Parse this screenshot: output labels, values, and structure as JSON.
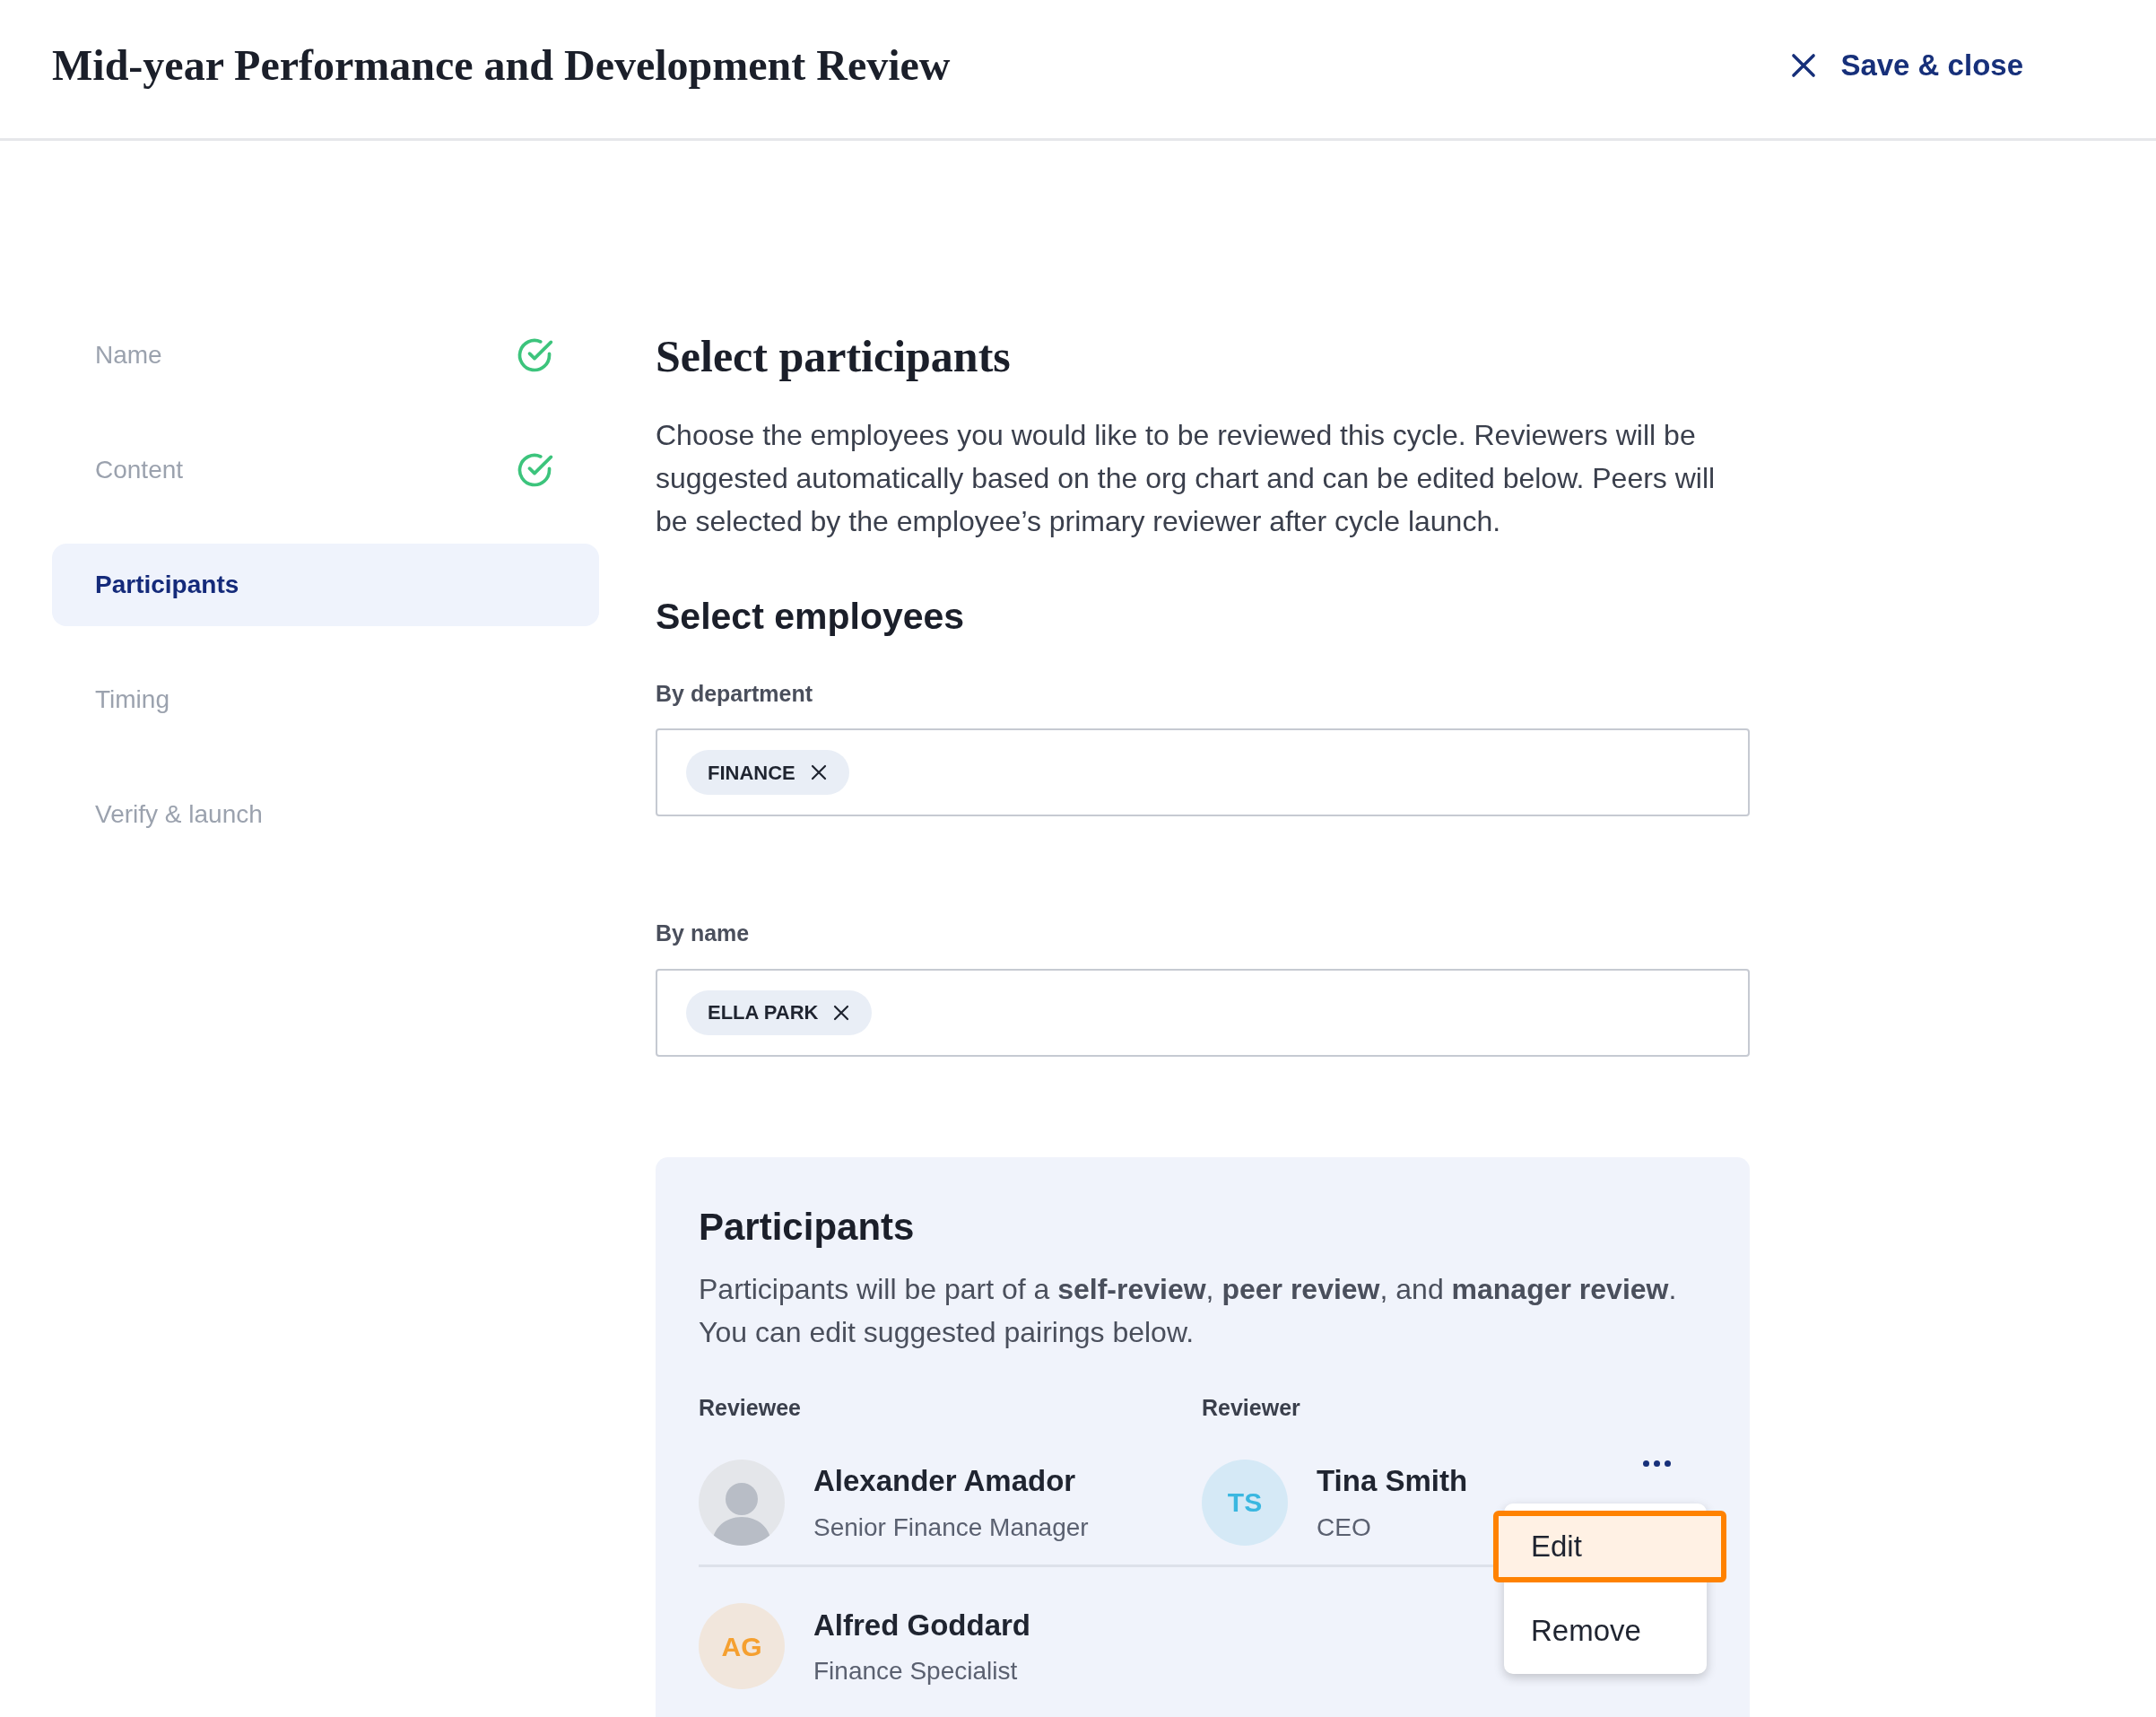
{
  "header": {
    "title": "Mid-year Performance and Development Review",
    "close_button": "Save & close"
  },
  "steps": [
    {
      "label": "Name",
      "completed": true,
      "selected": false
    },
    {
      "label": "Content",
      "completed": true,
      "selected": false
    },
    {
      "label": "Participants",
      "completed": false,
      "selected": true
    },
    {
      "label": "Timing",
      "completed": false,
      "selected": false
    },
    {
      "label": "Verify & launch",
      "completed": false,
      "selected": false
    }
  ],
  "main": {
    "title": "Select participants",
    "description": "Choose the employees you would like to be reviewed this cycle. Reviewers will be suggested automatically based on the org chart and can be edited below. Peers will be selected by the employee’s primary reviewer after cycle launch.",
    "section_title": "Select employees",
    "filters": [
      {
        "label": "By department",
        "tags": [
          "FINANCE"
        ]
      },
      {
        "label": "By name",
        "tags": [
          "ELLA PARK"
        ]
      }
    ]
  },
  "participants": {
    "title": "Participants",
    "description": "Participants will be part of a **self-review**, **peer review**, and **manager review**. You can edit suggested pairings below.",
    "columns": [
      "Reviewee",
      "Reviewer"
    ],
    "rows": [
      {
        "reviewee": {
          "name": "Alexander Amador",
          "role": "Senior Finance Manager",
          "avatar": {
            "kind": "photo"
          }
        },
        "reviewer": {
          "name": "Tina Smith",
          "role": "CEO",
          "avatar": {
            "kind": "initials",
            "initials": "TS",
            "color": "#3ab7e0"
          }
        },
        "menu": [
          {
            "label": "Edit",
            "selected": true
          },
          {
            "label": "Remove",
            "selected": false
          }
        ]
      },
      {
        "reviewee": {
          "name": "Alfred Goddard",
          "role": "Finance Specialist",
          "avatar": {
            "kind": "initials",
            "initials": "AG",
            "color": "#f5a030"
          }
        }
      }
    ]
  }
}
